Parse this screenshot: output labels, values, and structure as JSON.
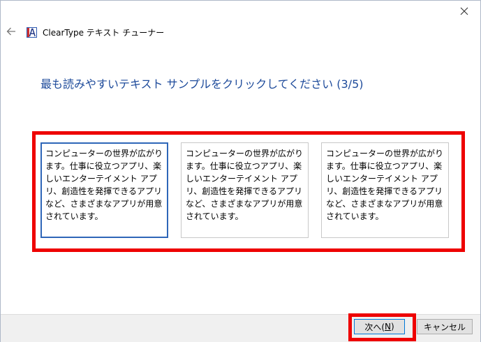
{
  "window": {
    "title": "ClearType テキスト チューナー"
  },
  "icons": {
    "close": "close-icon",
    "back": "back-arrow-icon",
    "app": "cleartype-app-icon"
  },
  "heading": "最も読みやすいテキスト サンプルをクリックしてください (3/5)",
  "samples": [
    {
      "text": "コンピューターの世界が広がります。仕事に役立つアプリ、楽しいエンターテイメント アプリ、創造性を発揮できるアプリなど、さまざまなアプリが用意されています。",
      "selected": true
    },
    {
      "text": "コンピューターの世界が広がります。仕事に役立つアプリ、楽しいエンターテイメント アプリ、創造性を発揮できるアプリなど、さまざまなアプリが用意されています。",
      "selected": false
    },
    {
      "text": "コンピューターの世界が広がります。仕事に役立つアプリ、楽しいエンターテイメント アプリ、創造性を発揮できるアプリなど、さまざまなアプリが用意されています。",
      "selected": false
    }
  ],
  "buttons": {
    "next_prefix": "次へ(",
    "next_key": "N",
    "next_suffix": ")",
    "cancel": "キャンセル"
  },
  "colors": {
    "heading": "#1e4b9b",
    "highlight": "#ee0000",
    "selected_border": "#2e66b8"
  }
}
